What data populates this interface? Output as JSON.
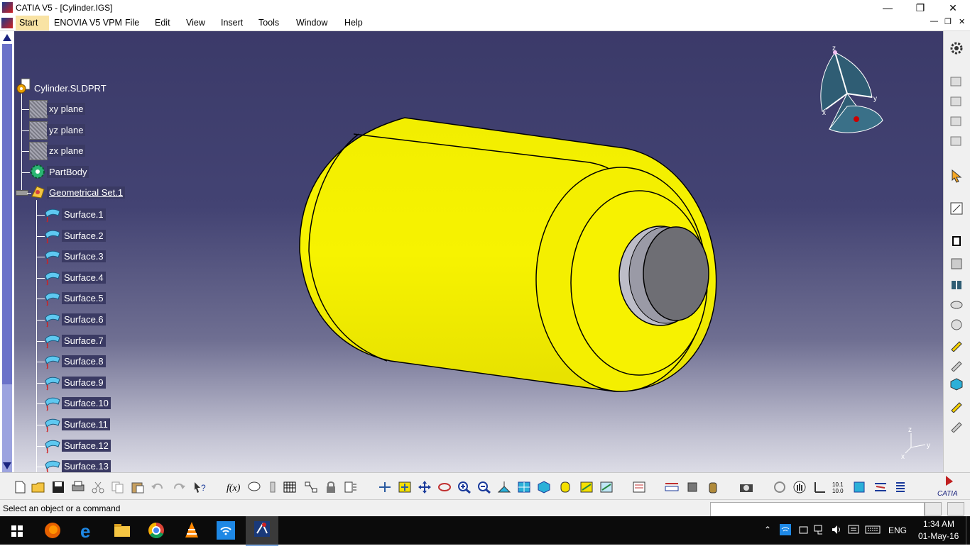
{
  "window": {
    "title": "CATIA V5 - [Cylinder.IGS]",
    "minimize_icon": "minimize-icon",
    "maximize_icon": "restore-icon",
    "close_icon": "close-icon"
  },
  "menubar": {
    "items": [
      "Start",
      "ENOVIA V5 VPM",
      "File",
      "Edit",
      "View",
      "Insert",
      "Tools",
      "Window",
      "Help"
    ]
  },
  "tree": {
    "root": "Cylinder.SLDPRT",
    "planes": [
      "xy plane",
      "yz plane",
      "zx plane"
    ],
    "partbody": "PartBody",
    "geoset": "Geometrical Set.1",
    "surfaces": [
      "Surface.1",
      "Surface.2",
      "Surface.3",
      "Surface.4",
      "Surface.5",
      "Surface.6",
      "Surface.7",
      "Surface.8",
      "Surface.9",
      "Surface.10",
      "Surface.11",
      "Surface.12",
      "Surface.13"
    ]
  },
  "compass": {
    "x_label": "x",
    "y_label": "y",
    "z_label": "z"
  },
  "axis_triad": {
    "x_label": "x",
    "y_label": "y",
    "z_label": "z"
  },
  "status": {
    "message": "Select an object or a command",
    "command_input": ""
  },
  "colors": {
    "part": "#f5f000",
    "background_top": "#3b3a69",
    "selection": "#3a3a63"
  },
  "taskbar": {
    "apps": [
      "start-icon",
      "firefox-icon",
      "edge-icon",
      "file-explorer-icon",
      "chrome-icon",
      "vlc-icon",
      "wifi-settings-icon",
      "catia-icon"
    ],
    "language": "ENG",
    "time": "1:34 AM",
    "date": "01-May-16"
  }
}
